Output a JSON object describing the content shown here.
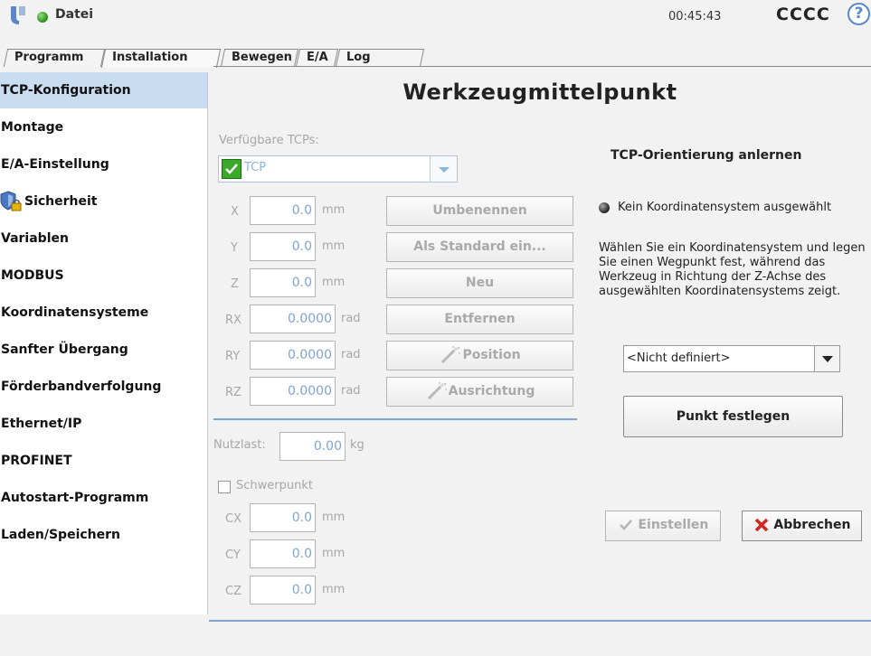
{
  "header": {
    "file_menu": "Datei",
    "clock": "00:45:43",
    "robot_name": "CCCC",
    "help": "?"
  },
  "tabs": [
    {
      "label": "Programm",
      "active": false
    },
    {
      "label": "Installation",
      "active": true
    },
    {
      "label": "Bewegen",
      "active": false
    },
    {
      "label": "E/A",
      "active": false
    },
    {
      "label": "Log",
      "active": false
    }
  ],
  "sidebar": {
    "items": [
      {
        "label": "TCP-Konfiguration",
        "selected": true
      },
      {
        "label": "Montage"
      },
      {
        "label": "E/A-Einstellung"
      },
      {
        "label": "Sicherheit",
        "icon": "shield-lock-icon"
      },
      {
        "label": "Variablen"
      },
      {
        "label": "MODBUS"
      },
      {
        "label": "Koordinatensysteme"
      },
      {
        "label": "Sanfter Übergang"
      },
      {
        "label": "Förderbandverfolgung"
      },
      {
        "label": "Ethernet/IP"
      },
      {
        "label": "PROFINET"
      },
      {
        "label": "Autostart-Programm"
      },
      {
        "label": "Laden/Speichern"
      }
    ]
  },
  "main": {
    "title": "Werkzeugmittelpunkt",
    "available_tcps_label": "Verfügbare TCPs:",
    "tcp_selected": "TCP",
    "pose": [
      {
        "axis": "X",
        "value": "0.0",
        "unit": "mm"
      },
      {
        "axis": "Y",
        "value": "0.0",
        "unit": "mm"
      },
      {
        "axis": "Z",
        "value": "0.0",
        "unit": "mm"
      },
      {
        "axis": "RX",
        "value": "0.0000",
        "unit": "rad"
      },
      {
        "axis": "RY",
        "value": "0.0000",
        "unit": "rad"
      },
      {
        "axis": "RZ",
        "value": "0.0000",
        "unit": "rad"
      }
    ],
    "buttons": {
      "rename": "Umbenennen",
      "set_default": "Als Standard ein...",
      "new": "Neu",
      "remove": "Entfernen",
      "position": "Position",
      "orientation": "Ausrichtung"
    },
    "payload_label": "Nutzlast:",
    "payload_value": "0.00",
    "payload_unit": "kg",
    "cog_label": "Schwerpunkt",
    "cog_checked": false,
    "cog": [
      {
        "axis": "CX",
        "value": "0.0",
        "unit": "mm"
      },
      {
        "axis": "CY",
        "value": "0.0",
        "unit": "mm"
      },
      {
        "axis": "CZ",
        "value": "0.0",
        "unit": "mm"
      }
    ],
    "orientation_panel": {
      "title": "TCP-Orientierung anlernen",
      "status": "Kein Koordinatensystem ausgewählt",
      "instructions": "Wählen Sie ein Koordinatensystem und legen Sie einen Wegpunkt fest, während das Werkzeug in Richtung der Z-Achse des ausgewählten Koordinatensystems zeigt.",
      "frame_select": "<Nicht definiert>",
      "set_point": "Punkt festlegen",
      "apply": "Einstellen",
      "cancel": "Abbrechen"
    }
  },
  "colors": {
    "accent_blue": "#7fa4cf",
    "selected_bg": "#c9dcf0",
    "status_green": "#3aa829",
    "cancel_red": "#d0261f"
  }
}
